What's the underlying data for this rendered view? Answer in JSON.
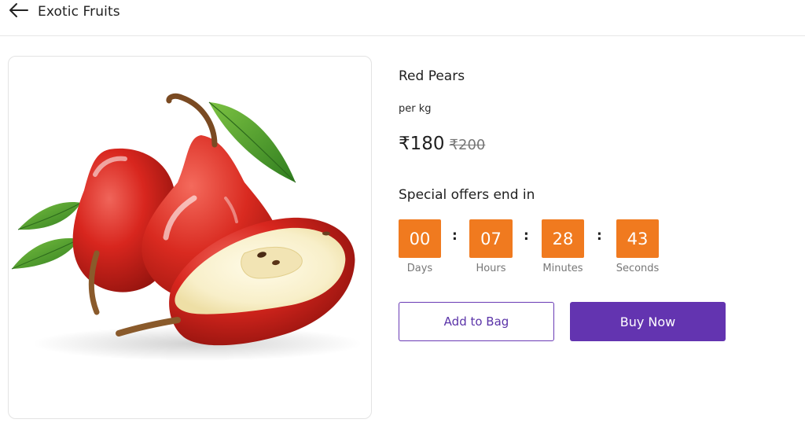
{
  "header": {
    "title": "Exotic Fruits",
    "back_icon": "arrow-left-icon"
  },
  "product": {
    "image": "red-pears-photo",
    "name": "Red Pears",
    "unit": "per kg",
    "price": "₹180",
    "mrp": "₹200"
  },
  "offer": {
    "title": "Special offers end in",
    "separator": ":",
    "timer": [
      {
        "value": "00",
        "label": "Days"
      },
      {
        "value": "07",
        "label": "Hours"
      },
      {
        "value": "28",
        "label": "Minutes"
      },
      {
        "value": "43",
        "label": "Seconds"
      }
    ]
  },
  "actions": {
    "add_to_bag": "Add to Bag",
    "buy_now": "Buy Now"
  },
  "colors": {
    "accent": "#6334b0",
    "timer": "#f07a1f"
  }
}
